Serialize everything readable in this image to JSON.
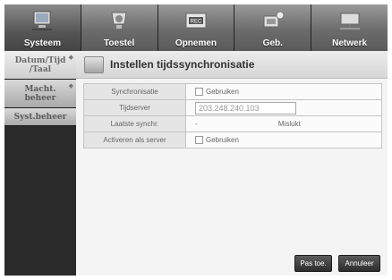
{
  "topnav": {
    "tabs": [
      {
        "label": "Systeem",
        "icon": "monitor-icon"
      },
      {
        "label": "Toestel",
        "icon": "camera-icon"
      },
      {
        "label": "Opnemen",
        "icon": "rec-icon"
      },
      {
        "label": "Geb.",
        "icon": "event-icon"
      },
      {
        "label": "Netwerk",
        "icon": "network-icon"
      }
    ]
  },
  "sidebar": {
    "items": [
      {
        "label_line1": "Datum/Tijd",
        "label_line2": "/Taal"
      },
      {
        "label_line1": "Macht.",
        "label_line2": "beheer"
      },
      {
        "label_line1": "Syst.beheer",
        "label_line2": ""
      }
    ]
  },
  "page": {
    "title": "Instellen tijdssynchronisatie",
    "rows": {
      "sync_label": "Synchronisatie",
      "sync_checkbox": "Gebruiken",
      "server_label": "Tijdserver",
      "server_value": "203.248.240.103",
      "last_sync_label": "Laatste synchr.",
      "last_sync_value": "-",
      "last_sync_status": "Mislukt",
      "server_mode_label": "Activeren als server",
      "server_mode_checkbox": "Gebruiken"
    }
  },
  "buttons": {
    "apply": "Pas toe.",
    "cancel": "Annuleer"
  }
}
